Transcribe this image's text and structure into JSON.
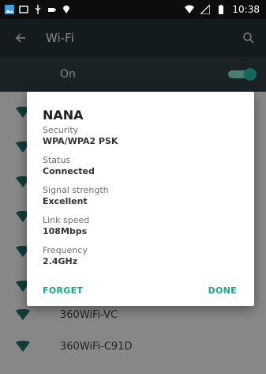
{
  "status_bar": {
    "time": "10:38",
    "icons": [
      "gallery-icon",
      "screen-icon",
      "usb-icon",
      "battery-plug-icon",
      "location-icon",
      "wifi-icon",
      "signal-icon",
      "battery-icon"
    ]
  },
  "app_bar": {
    "title": "Wi-Fi",
    "back_icon": "arrow-left-icon",
    "search_icon": "search-icon"
  },
  "wifi_toggle": {
    "label": "On",
    "state": "on"
  },
  "networks": [
    {
      "name": "360WiFi-VC"
    },
    {
      "name": "360WiFi-C91D"
    }
  ],
  "dialog": {
    "title": "NANA",
    "fields": [
      {
        "label": "Security",
        "value": "WPA/WPA2 PSK"
      },
      {
        "label": "Status",
        "value": "Connected"
      },
      {
        "label": "Signal strength",
        "value": "Excellent"
      },
      {
        "label": "Link speed",
        "value": "108Mbps"
      },
      {
        "label": "Frequency",
        "value": "2.4GHz"
      }
    ],
    "forget_label": "FORGET",
    "done_label": "DONE"
  },
  "colors": {
    "accent": "#17a88e",
    "app_bar": "#232f33",
    "toggle_row": "#2e3b40",
    "wifi_icon": "#1e6b63"
  }
}
